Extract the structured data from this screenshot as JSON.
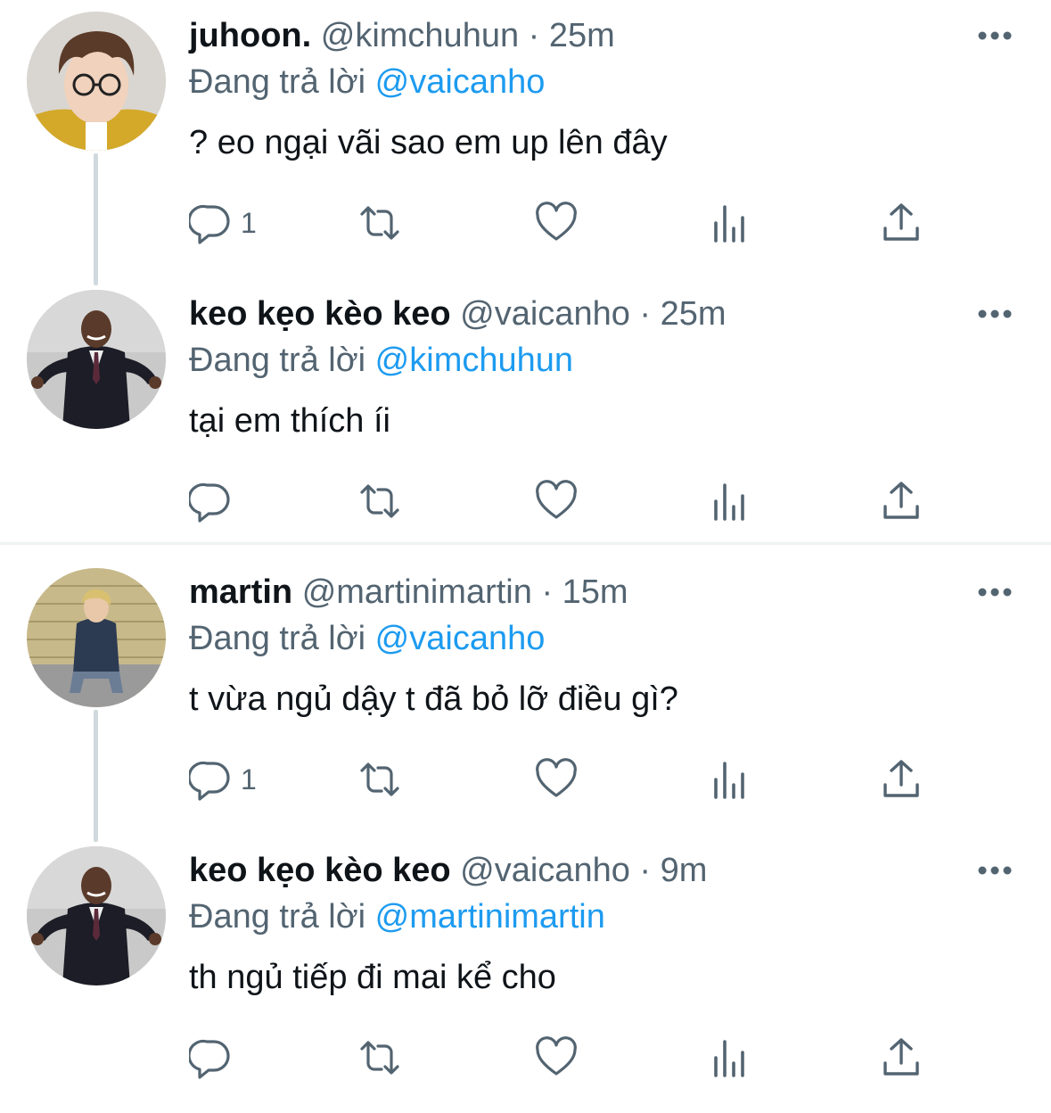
{
  "tweets": [
    {
      "name": "juhoon.",
      "handle": "@kimchuhun",
      "separator": "·",
      "time": "25m",
      "reply_prefix": "Đang trả lời",
      "reply_to": "@vaicanho",
      "text": "? eo ngại vãi sao em up lên đây",
      "reply_count": "1"
    },
    {
      "name": "keo kẹo kèo keo",
      "handle": "@vaicanho",
      "separator": "·",
      "time": "25m",
      "reply_prefix": "Đang trả lời",
      "reply_to": "@kimchuhun",
      "text": "tại em thích íi",
      "reply_count": ""
    },
    {
      "name": "martin",
      "handle": "@martinimartin",
      "separator": "·",
      "time": "15m",
      "reply_prefix": "Đang trả lời",
      "reply_to": "@vaicanho",
      "text": "t vừa ngủ dậy t đã bỏ lỡ điều gì?",
      "reply_count": "1"
    },
    {
      "name": "keo kẹo kèo keo",
      "handle": "@vaicanho",
      "separator": "·",
      "time": "9m",
      "reply_prefix": "Đang trả lời",
      "reply_to": "@martinimartin",
      "text": "th ngủ tiếp đi mai kể cho",
      "reply_count": ""
    }
  ],
  "icons": [
    "reply-icon",
    "retweet-icon",
    "like-icon",
    "views-icon",
    "share-icon",
    "more-icon"
  ],
  "colors": {
    "text_primary": "#0f1419",
    "text_secondary": "#536471",
    "mention_blue": "#1d9bf0",
    "thread_line": "#cfd9de",
    "divider": "#eff3f4"
  }
}
